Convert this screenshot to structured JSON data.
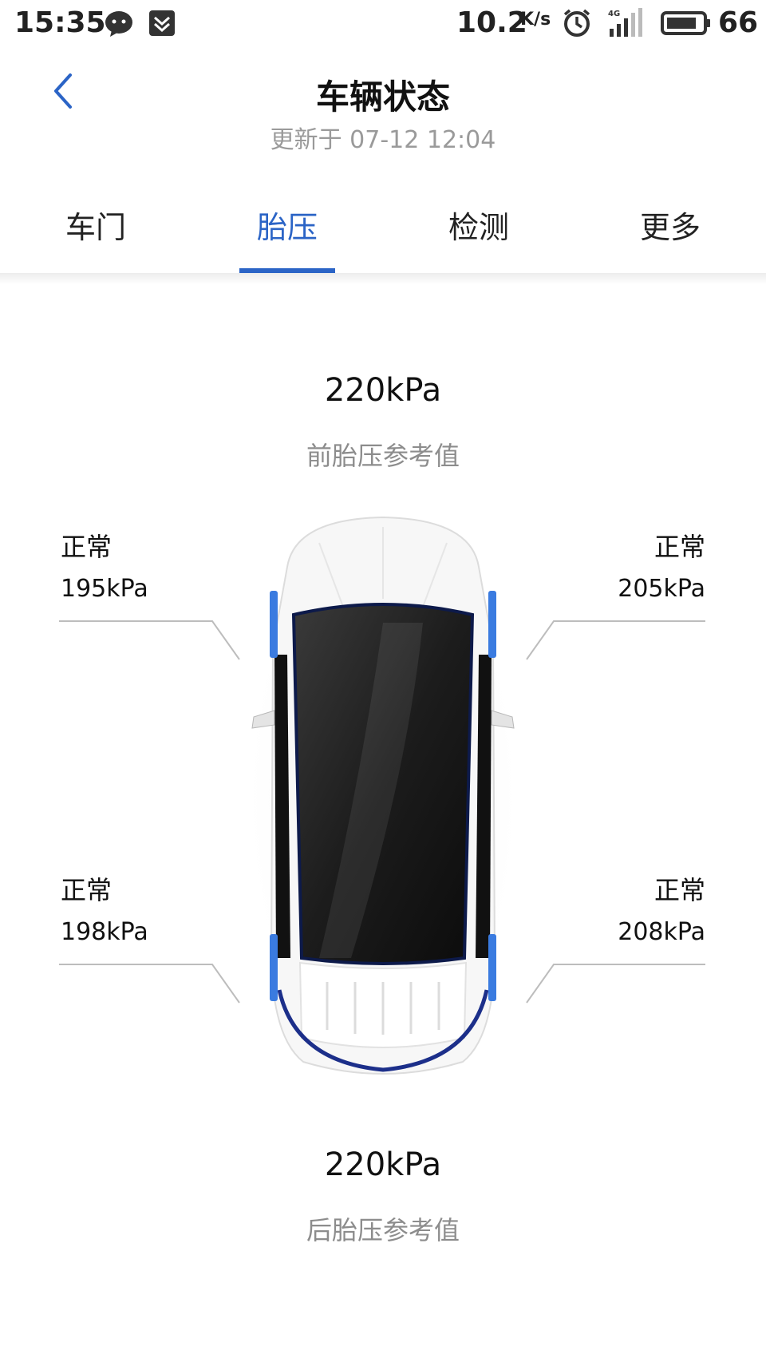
{
  "status_bar": {
    "time": "15:35",
    "speed": "10.2",
    "speed_unit": "K/s",
    "network": "4G",
    "battery": "66",
    "icons": [
      "chat-icon",
      "shield-icon",
      "alarm-icon",
      "signal-icon",
      "battery-icon"
    ]
  },
  "header": {
    "title": "车辆状态",
    "subtitle": "更新于 07-12 12:04"
  },
  "tabs": [
    {
      "label": "车门",
      "active": false
    },
    {
      "label": "胎压",
      "active": true
    },
    {
      "label": "检测",
      "active": false
    },
    {
      "label": "更多",
      "active": false
    }
  ],
  "front_reference": {
    "value": "220kPa",
    "label": "前胎压参考值"
  },
  "rear_reference": {
    "value": "220kPa",
    "label": "后胎压参考值"
  },
  "tires": {
    "front_left": {
      "status": "正常",
      "pressure": "195kPa"
    },
    "front_right": {
      "status": "正常",
      "pressure": "205kPa"
    },
    "rear_left": {
      "status": "正常",
      "pressure": "198kPa"
    },
    "rear_right": {
      "status": "正常",
      "pressure": "208kPa"
    }
  },
  "colors": {
    "accent": "#2b64c6",
    "secondary_text": "#8c8c8c"
  }
}
